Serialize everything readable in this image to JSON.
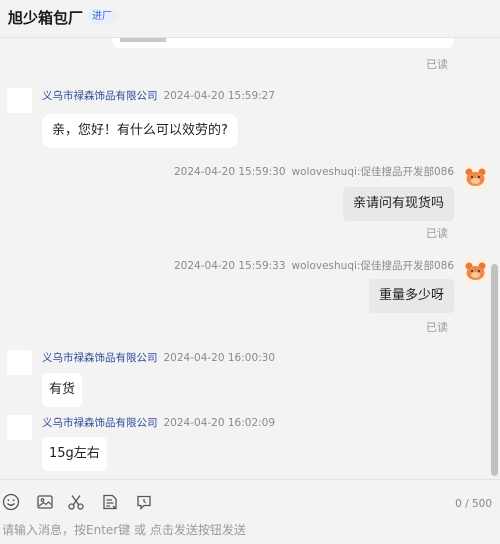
{
  "header": {
    "shop_name": "旭少箱包厂",
    "badge": "进厂"
  },
  "messages": {
    "read_label": "已读",
    "partial_text": "有现",
    "supplier_name": "义乌市禄森饰品有限公司",
    "my_name": "woloveshuqi:促佳搜品开发部086",
    "m1": {
      "time": "2024-04-20 15:59:27",
      "text": "亲，您好！有什么可以效劳的?"
    },
    "m2": {
      "time": "2024-04-20 15:59:30",
      "text": "亲请问有现货吗"
    },
    "m3": {
      "time": "2024-04-20 15:59:33",
      "text": "重量多少呀"
    },
    "m4": {
      "time": "2024-04-20 16:00:30",
      "text": "有货"
    },
    "m5": {
      "time": "2024-04-20 16:02:09",
      "text": "15g左右"
    }
  },
  "composer": {
    "counter": "0 / 500",
    "placeholder": "请输入消息，按Enter键 或 点击发送按钮发送",
    "tools": [
      "emoji-icon",
      "image-icon",
      "scissors-icon",
      "document-icon",
      "history-icon"
    ]
  }
}
